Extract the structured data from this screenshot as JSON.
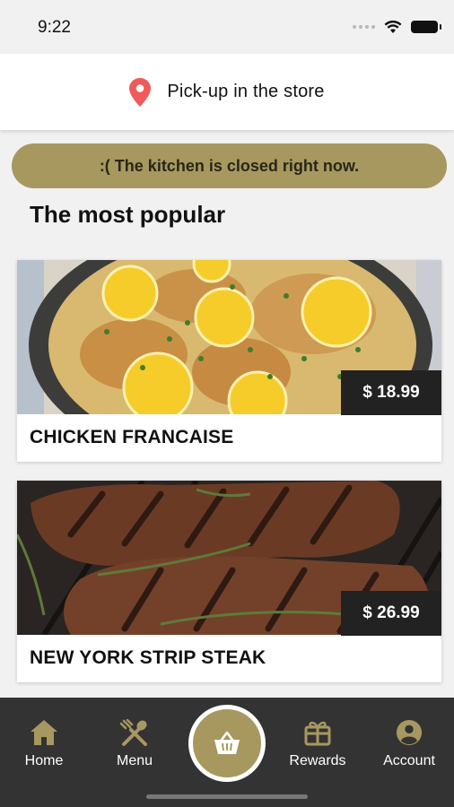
{
  "status_bar": {
    "time": "9:22",
    "icons": [
      "signal-icon",
      "wifi-icon",
      "battery-icon"
    ]
  },
  "header": {
    "pickup_label": "Pick-up in the store",
    "icon": "location-pin-icon",
    "pin_color": "#ef5b5b"
  },
  "banner": {
    "message": ":( The kitchen is closed right now.",
    "color": "#a79860"
  },
  "section": {
    "title": "The most popular"
  },
  "products": [
    {
      "name": "CHICKEN FRANCAISE",
      "price": "$ 18.99",
      "image": "chicken-francaise-photo"
    },
    {
      "name": "NEW YORK STRIP STEAK",
      "price": "$ 26.99",
      "image": "strip-steak-photo"
    }
  ],
  "nav": {
    "items": [
      {
        "label": "Home",
        "icon": "home-icon"
      },
      {
        "label": "Menu",
        "icon": "utensils-icon"
      },
      {
        "label": "",
        "icon": "basket-icon"
      },
      {
        "label": "Rewards",
        "icon": "gift-icon"
      },
      {
        "label": "Account",
        "icon": "user-icon"
      }
    ],
    "accent": "#a79860",
    "background": "#333333"
  }
}
